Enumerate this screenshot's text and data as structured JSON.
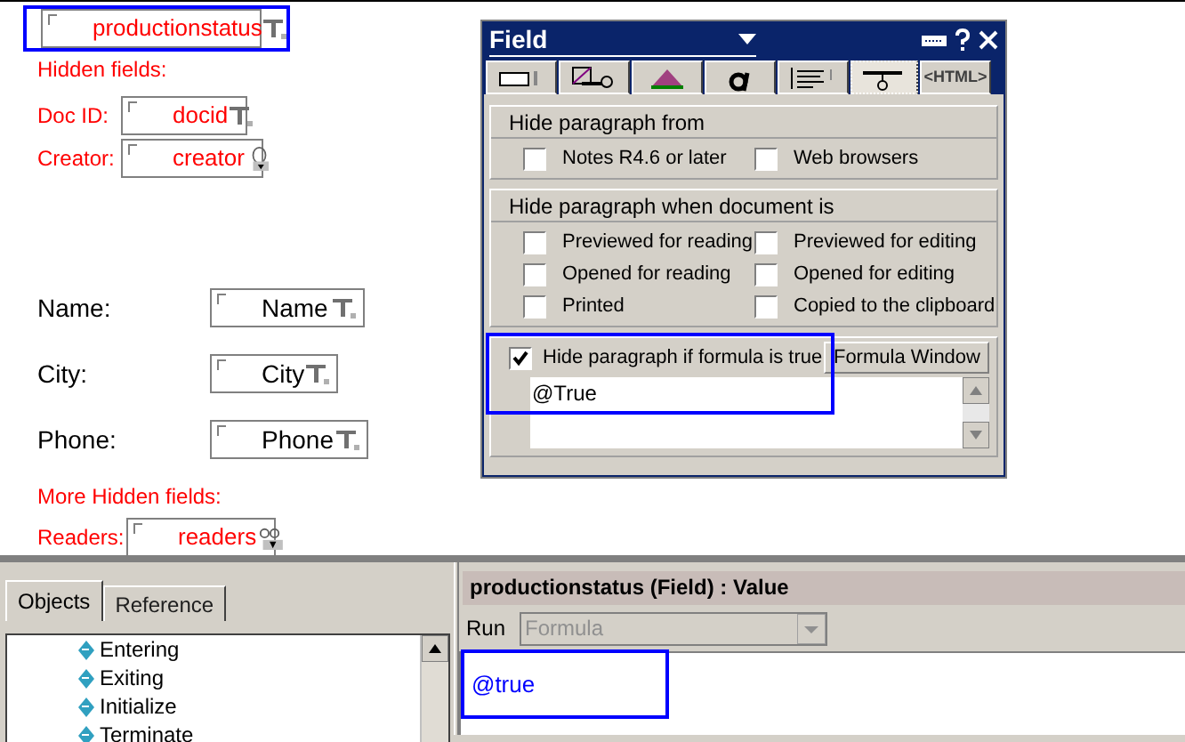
{
  "form": {
    "top_field": {
      "name": "productionstatus",
      "kind": "text",
      "highlighted": true
    },
    "hidden_label": "Hidden fields:",
    "hidden_rows": [
      {
        "label": "Doc ID:",
        "field": "docid",
        "kind": "text"
      },
      {
        "label": "Creator:",
        "field": "creator",
        "kind": "names"
      }
    ],
    "rows": [
      {
        "label": "Name:",
        "field": "Name",
        "kind": "text"
      },
      {
        "label": "City:",
        "field": "City",
        "kind": "text"
      },
      {
        "label": "Phone:",
        "field": "Phone",
        "kind": "text"
      }
    ],
    "more_hidden_label": "More Hidden fields:",
    "more_rows": [
      {
        "label": "Readers:",
        "field": "readers",
        "kind": "readers"
      }
    ]
  },
  "dialog": {
    "title": "Field",
    "tabs": [
      {
        "kind": "basics",
        "selected": false
      },
      {
        "kind": "control",
        "selected": false
      },
      {
        "kind": "advanced",
        "selected": false
      },
      {
        "kind": "font",
        "selected": false
      },
      {
        "kind": "paragraph",
        "selected": false
      },
      {
        "kind": "hide",
        "selected": true
      },
      {
        "kind": "html",
        "label": "<HTML>",
        "selected": false
      }
    ],
    "hide_from": {
      "title": "Hide paragraph from",
      "options": [
        {
          "label": "Notes R4.6 or later",
          "checked": false
        },
        {
          "label": "Web browsers",
          "checked": false
        }
      ]
    },
    "hide_when": {
      "title": "Hide paragraph when document is",
      "options": [
        {
          "label": "Previewed for reading",
          "checked": false
        },
        {
          "label": "Previewed for editing",
          "checked": false
        },
        {
          "label": "Opened for reading",
          "checked": false
        },
        {
          "label": "Opened for editing",
          "checked": false
        },
        {
          "label": "Printed",
          "checked": false
        },
        {
          "label": "Copied to the clipboard",
          "checked": false
        }
      ]
    },
    "formula": {
      "label": "Hide paragraph if formula is true",
      "checked": true,
      "highlighted": true,
      "button": "Formula Window",
      "value": "@True"
    }
  },
  "objects_pane": {
    "tabs": [
      {
        "label": "Objects",
        "selected": true
      },
      {
        "label": "Reference",
        "selected": false
      }
    ],
    "items": [
      {
        "label": "Entering"
      },
      {
        "label": "Exiting"
      },
      {
        "label": "Initialize"
      },
      {
        "label": "Terminate"
      }
    ]
  },
  "code_pane": {
    "header": "productionstatus (Field) : Value",
    "run_label": "Run",
    "run_value": "Formula",
    "run_disabled": true,
    "code": "@true",
    "highlighted": true
  }
}
